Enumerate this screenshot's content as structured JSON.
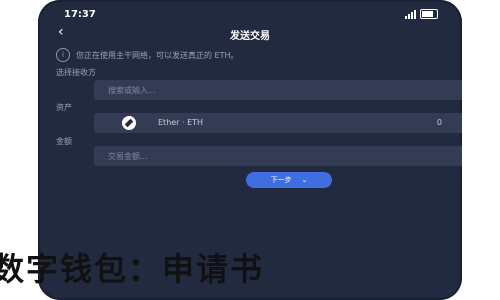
{
  "status_bar": {
    "time": "17:37"
  },
  "header": {
    "title": "发送交易",
    "back_icon": "chevron-left-icon"
  },
  "notice": {
    "icon": "info-icon",
    "text": "您正在使用主干网络，可以发送真正的 ETH。"
  },
  "form": {
    "network_label": "选择接收方",
    "network_placeholder": "搜索或输入...",
    "asset_label": "资产",
    "asset_name": "Ether · ETH",
    "asset_balance": "0",
    "amount_label": "金额",
    "amount_placeholder": "交易金额..."
  },
  "next_button": {
    "label": "下一步"
  },
  "overlay_caption": "数字钱包：申请书"
}
